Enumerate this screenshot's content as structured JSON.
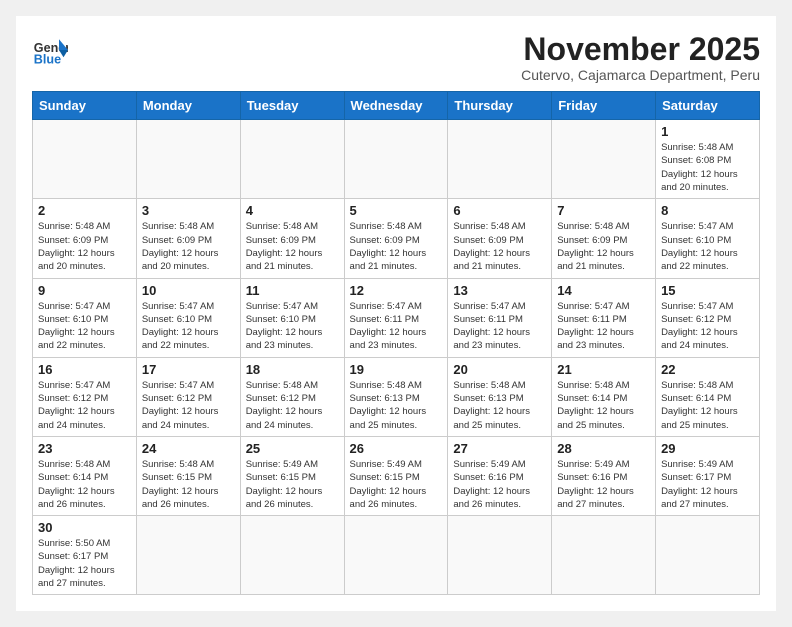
{
  "logo": {
    "text_general": "General",
    "text_blue": "Blue"
  },
  "title": "November 2025",
  "subtitle": "Cutervo, Cajamarca Department, Peru",
  "days_of_week": [
    "Sunday",
    "Monday",
    "Tuesday",
    "Wednesday",
    "Thursday",
    "Friday",
    "Saturday"
  ],
  "weeks": [
    [
      {
        "day": null,
        "info": ""
      },
      {
        "day": null,
        "info": ""
      },
      {
        "day": null,
        "info": ""
      },
      {
        "day": null,
        "info": ""
      },
      {
        "day": null,
        "info": ""
      },
      {
        "day": null,
        "info": ""
      },
      {
        "day": "1",
        "info": "Sunrise: 5:48 AM\nSunset: 6:08 PM\nDaylight: 12 hours and 20 minutes."
      }
    ],
    [
      {
        "day": "2",
        "info": "Sunrise: 5:48 AM\nSunset: 6:09 PM\nDaylight: 12 hours and 20 minutes."
      },
      {
        "day": "3",
        "info": "Sunrise: 5:48 AM\nSunset: 6:09 PM\nDaylight: 12 hours and 20 minutes."
      },
      {
        "day": "4",
        "info": "Sunrise: 5:48 AM\nSunset: 6:09 PM\nDaylight: 12 hours and 21 minutes."
      },
      {
        "day": "5",
        "info": "Sunrise: 5:48 AM\nSunset: 6:09 PM\nDaylight: 12 hours and 21 minutes."
      },
      {
        "day": "6",
        "info": "Sunrise: 5:48 AM\nSunset: 6:09 PM\nDaylight: 12 hours and 21 minutes."
      },
      {
        "day": "7",
        "info": "Sunrise: 5:48 AM\nSunset: 6:09 PM\nDaylight: 12 hours and 21 minutes."
      },
      {
        "day": "8",
        "info": "Sunrise: 5:47 AM\nSunset: 6:10 PM\nDaylight: 12 hours and 22 minutes."
      }
    ],
    [
      {
        "day": "9",
        "info": "Sunrise: 5:47 AM\nSunset: 6:10 PM\nDaylight: 12 hours and 22 minutes."
      },
      {
        "day": "10",
        "info": "Sunrise: 5:47 AM\nSunset: 6:10 PM\nDaylight: 12 hours and 22 minutes."
      },
      {
        "day": "11",
        "info": "Sunrise: 5:47 AM\nSunset: 6:10 PM\nDaylight: 12 hours and 23 minutes."
      },
      {
        "day": "12",
        "info": "Sunrise: 5:47 AM\nSunset: 6:11 PM\nDaylight: 12 hours and 23 minutes."
      },
      {
        "day": "13",
        "info": "Sunrise: 5:47 AM\nSunset: 6:11 PM\nDaylight: 12 hours and 23 minutes."
      },
      {
        "day": "14",
        "info": "Sunrise: 5:47 AM\nSunset: 6:11 PM\nDaylight: 12 hours and 23 minutes."
      },
      {
        "day": "15",
        "info": "Sunrise: 5:47 AM\nSunset: 6:12 PM\nDaylight: 12 hours and 24 minutes."
      }
    ],
    [
      {
        "day": "16",
        "info": "Sunrise: 5:47 AM\nSunset: 6:12 PM\nDaylight: 12 hours and 24 minutes."
      },
      {
        "day": "17",
        "info": "Sunrise: 5:47 AM\nSunset: 6:12 PM\nDaylight: 12 hours and 24 minutes."
      },
      {
        "day": "18",
        "info": "Sunrise: 5:48 AM\nSunset: 6:12 PM\nDaylight: 12 hours and 24 minutes."
      },
      {
        "day": "19",
        "info": "Sunrise: 5:48 AM\nSunset: 6:13 PM\nDaylight: 12 hours and 25 minutes."
      },
      {
        "day": "20",
        "info": "Sunrise: 5:48 AM\nSunset: 6:13 PM\nDaylight: 12 hours and 25 minutes."
      },
      {
        "day": "21",
        "info": "Sunrise: 5:48 AM\nSunset: 6:14 PM\nDaylight: 12 hours and 25 minutes."
      },
      {
        "day": "22",
        "info": "Sunrise: 5:48 AM\nSunset: 6:14 PM\nDaylight: 12 hours and 25 minutes."
      }
    ],
    [
      {
        "day": "23",
        "info": "Sunrise: 5:48 AM\nSunset: 6:14 PM\nDaylight: 12 hours and 26 minutes."
      },
      {
        "day": "24",
        "info": "Sunrise: 5:48 AM\nSunset: 6:15 PM\nDaylight: 12 hours and 26 minutes."
      },
      {
        "day": "25",
        "info": "Sunrise: 5:49 AM\nSunset: 6:15 PM\nDaylight: 12 hours and 26 minutes."
      },
      {
        "day": "26",
        "info": "Sunrise: 5:49 AM\nSunset: 6:15 PM\nDaylight: 12 hours and 26 minutes."
      },
      {
        "day": "27",
        "info": "Sunrise: 5:49 AM\nSunset: 6:16 PM\nDaylight: 12 hours and 26 minutes."
      },
      {
        "day": "28",
        "info": "Sunrise: 5:49 AM\nSunset: 6:16 PM\nDaylight: 12 hours and 27 minutes."
      },
      {
        "day": "29",
        "info": "Sunrise: 5:49 AM\nSunset: 6:17 PM\nDaylight: 12 hours and 27 minutes."
      }
    ],
    [
      {
        "day": "30",
        "info": "Sunrise: 5:50 AM\nSunset: 6:17 PM\nDaylight: 12 hours and 27 minutes."
      },
      {
        "day": null,
        "info": ""
      },
      {
        "day": null,
        "info": ""
      },
      {
        "day": null,
        "info": ""
      },
      {
        "day": null,
        "info": ""
      },
      {
        "day": null,
        "info": ""
      },
      {
        "day": null,
        "info": ""
      }
    ]
  ]
}
